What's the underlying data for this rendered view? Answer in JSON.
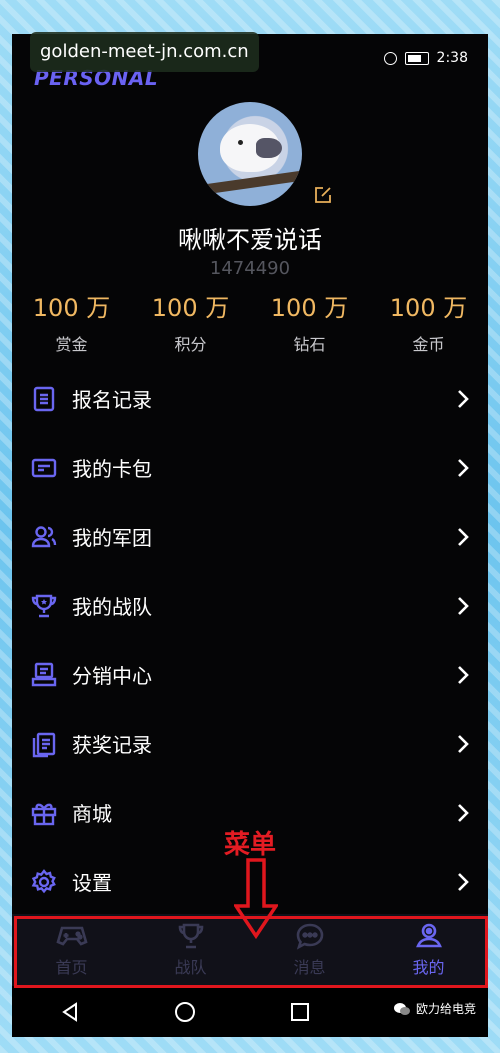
{
  "watermark": "golden-meet-jn.com.cn",
  "status_bar": {
    "time": "2:38"
  },
  "header": {
    "title": "PERSONAL"
  },
  "profile": {
    "username": "啾啾不爱说话",
    "user_id": "1474490"
  },
  "stats": [
    {
      "value": "100 万",
      "label": "赏金"
    },
    {
      "value": "100 万",
      "label": "积分"
    },
    {
      "value": "100 万",
      "label": "钻石"
    },
    {
      "value": "100 万",
      "label": "金币"
    }
  ],
  "menu": [
    {
      "label": "报名记录",
      "icon": "list-doc-icon"
    },
    {
      "label": "我的卡包",
      "icon": "card-wallet-icon"
    },
    {
      "label": "我的军团",
      "icon": "group-icon"
    },
    {
      "label": "我的战队",
      "icon": "trophy-icon"
    },
    {
      "label": "分销中心",
      "icon": "distribution-icon"
    },
    {
      "label": "获奖记录",
      "icon": "award-record-icon"
    },
    {
      "label": "商城",
      "icon": "gift-icon"
    },
    {
      "label": "设置",
      "icon": "gear-icon"
    }
  ],
  "annotation": {
    "text": "菜单"
  },
  "tabbar": [
    {
      "label": "首页",
      "icon": "gamepad-icon",
      "active": false
    },
    {
      "label": "战队",
      "icon": "trophy-icon",
      "active": false
    },
    {
      "label": "消息",
      "icon": "chat-icon",
      "active": false
    },
    {
      "label": "我的",
      "icon": "user-icon",
      "active": true
    }
  ],
  "wechat_label": "欧力给电竞",
  "colors": {
    "accent": "#6a66f0",
    "gold": "#f0b862",
    "annotation": "#e0161d",
    "background": "#050506"
  }
}
